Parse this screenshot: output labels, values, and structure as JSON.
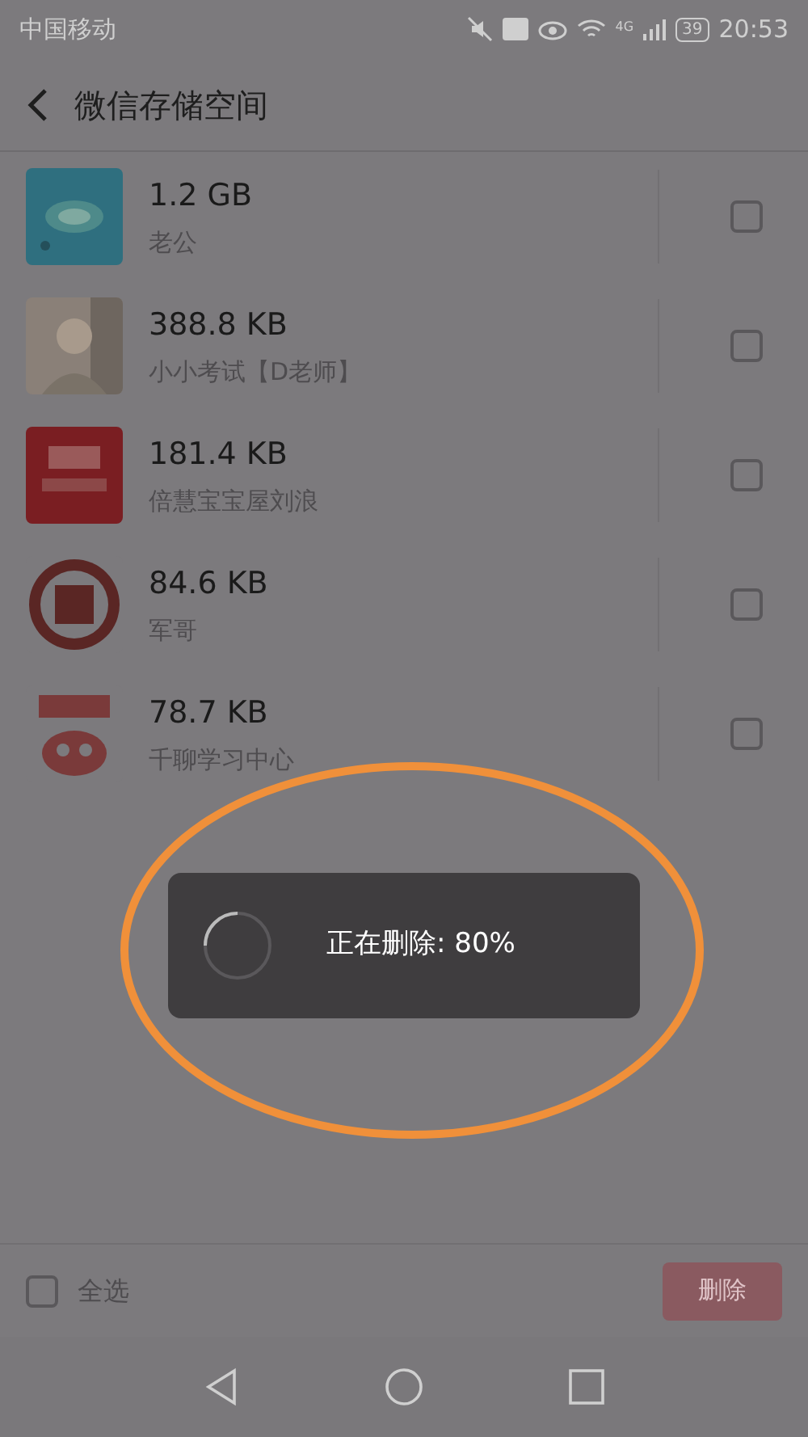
{
  "status_bar": {
    "carrier": "中国移动",
    "network": "4G",
    "battery": "39",
    "time": "20:53"
  },
  "header": {
    "title": "微信存储空间"
  },
  "items": [
    {
      "size": "1.2 GB",
      "name": "老公",
      "checked": false
    },
    {
      "size": "388.8 KB",
      "name": "小小考试【D老师】",
      "checked": false
    },
    {
      "size": "181.4 KB",
      "name": "倍慧宝宝屋刘浪",
      "checked": false
    },
    {
      "size": "84.6 KB",
      "name": "军哥",
      "checked": false
    },
    {
      "size": "78.7 KB",
      "name": "千聊学习中心",
      "checked": false
    }
  ],
  "dialog": {
    "message": "正在删除: 80%"
  },
  "footer": {
    "select_all": {
      "label": "全选",
      "checked": false
    },
    "delete_button": {
      "label": "删除",
      "disabled": true
    }
  }
}
